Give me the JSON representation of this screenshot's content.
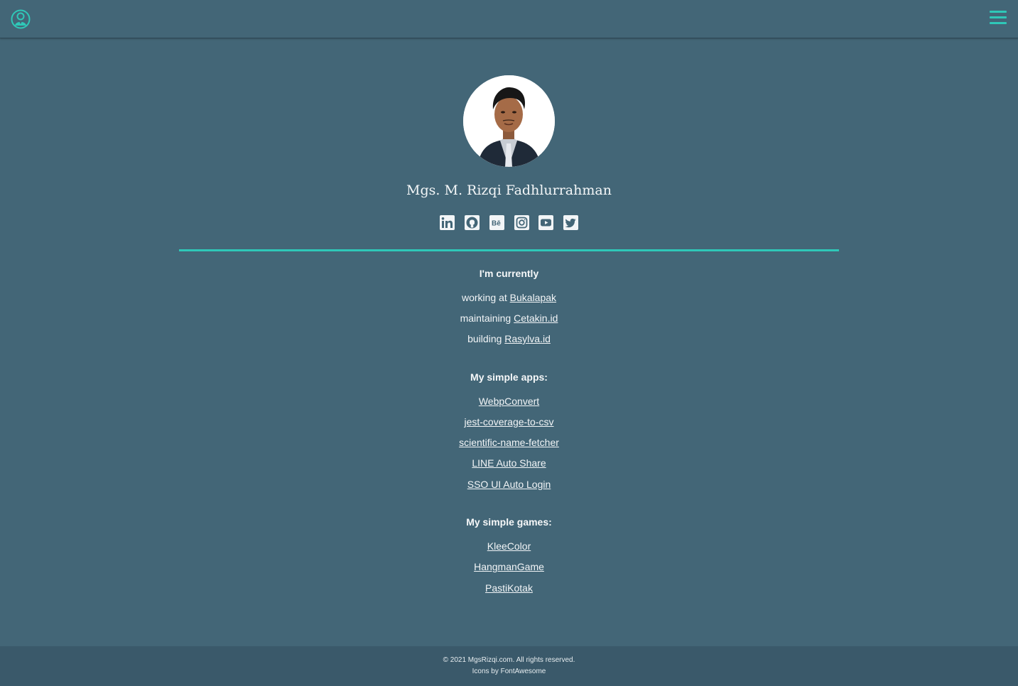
{
  "header": {
    "logo_icon": "person-circle-icon",
    "menu_icon": "hamburger-menu-icon",
    "accent_color": "#2fc8b8"
  },
  "profile": {
    "name": "Mgs. M. Rizqi Fadhlurrahman",
    "avatar_icon": "profile-photo"
  },
  "socials": [
    {
      "icon": "linkedin-icon"
    },
    {
      "icon": "github-icon"
    },
    {
      "icon": "behance-icon"
    },
    {
      "icon": "instagram-icon"
    },
    {
      "icon": "youtube-icon"
    },
    {
      "icon": "twitter-icon"
    }
  ],
  "currently": {
    "title": "I'm currently",
    "items": [
      {
        "prefix": "working at ",
        "link": "Bukalapak"
      },
      {
        "prefix": "maintaining ",
        "link": "Cetakin.id"
      },
      {
        "prefix": "building ",
        "link": "Rasylva.id"
      }
    ]
  },
  "apps": {
    "title": "My simple apps:",
    "items": [
      "WebpConvert",
      "jest-coverage-to-csv",
      "scientific-name-fetcher",
      "LINE Auto Share",
      "SSO UI Auto Login"
    ]
  },
  "games": {
    "title": "My simple games:",
    "items": [
      "KleeColor",
      "HangmanGame",
      "PastiKotak"
    ]
  },
  "footer": {
    "copyright": "© 2021 MgsRizqi.com. All rights reserved.",
    "credits": "Icons by FontAwesome"
  }
}
